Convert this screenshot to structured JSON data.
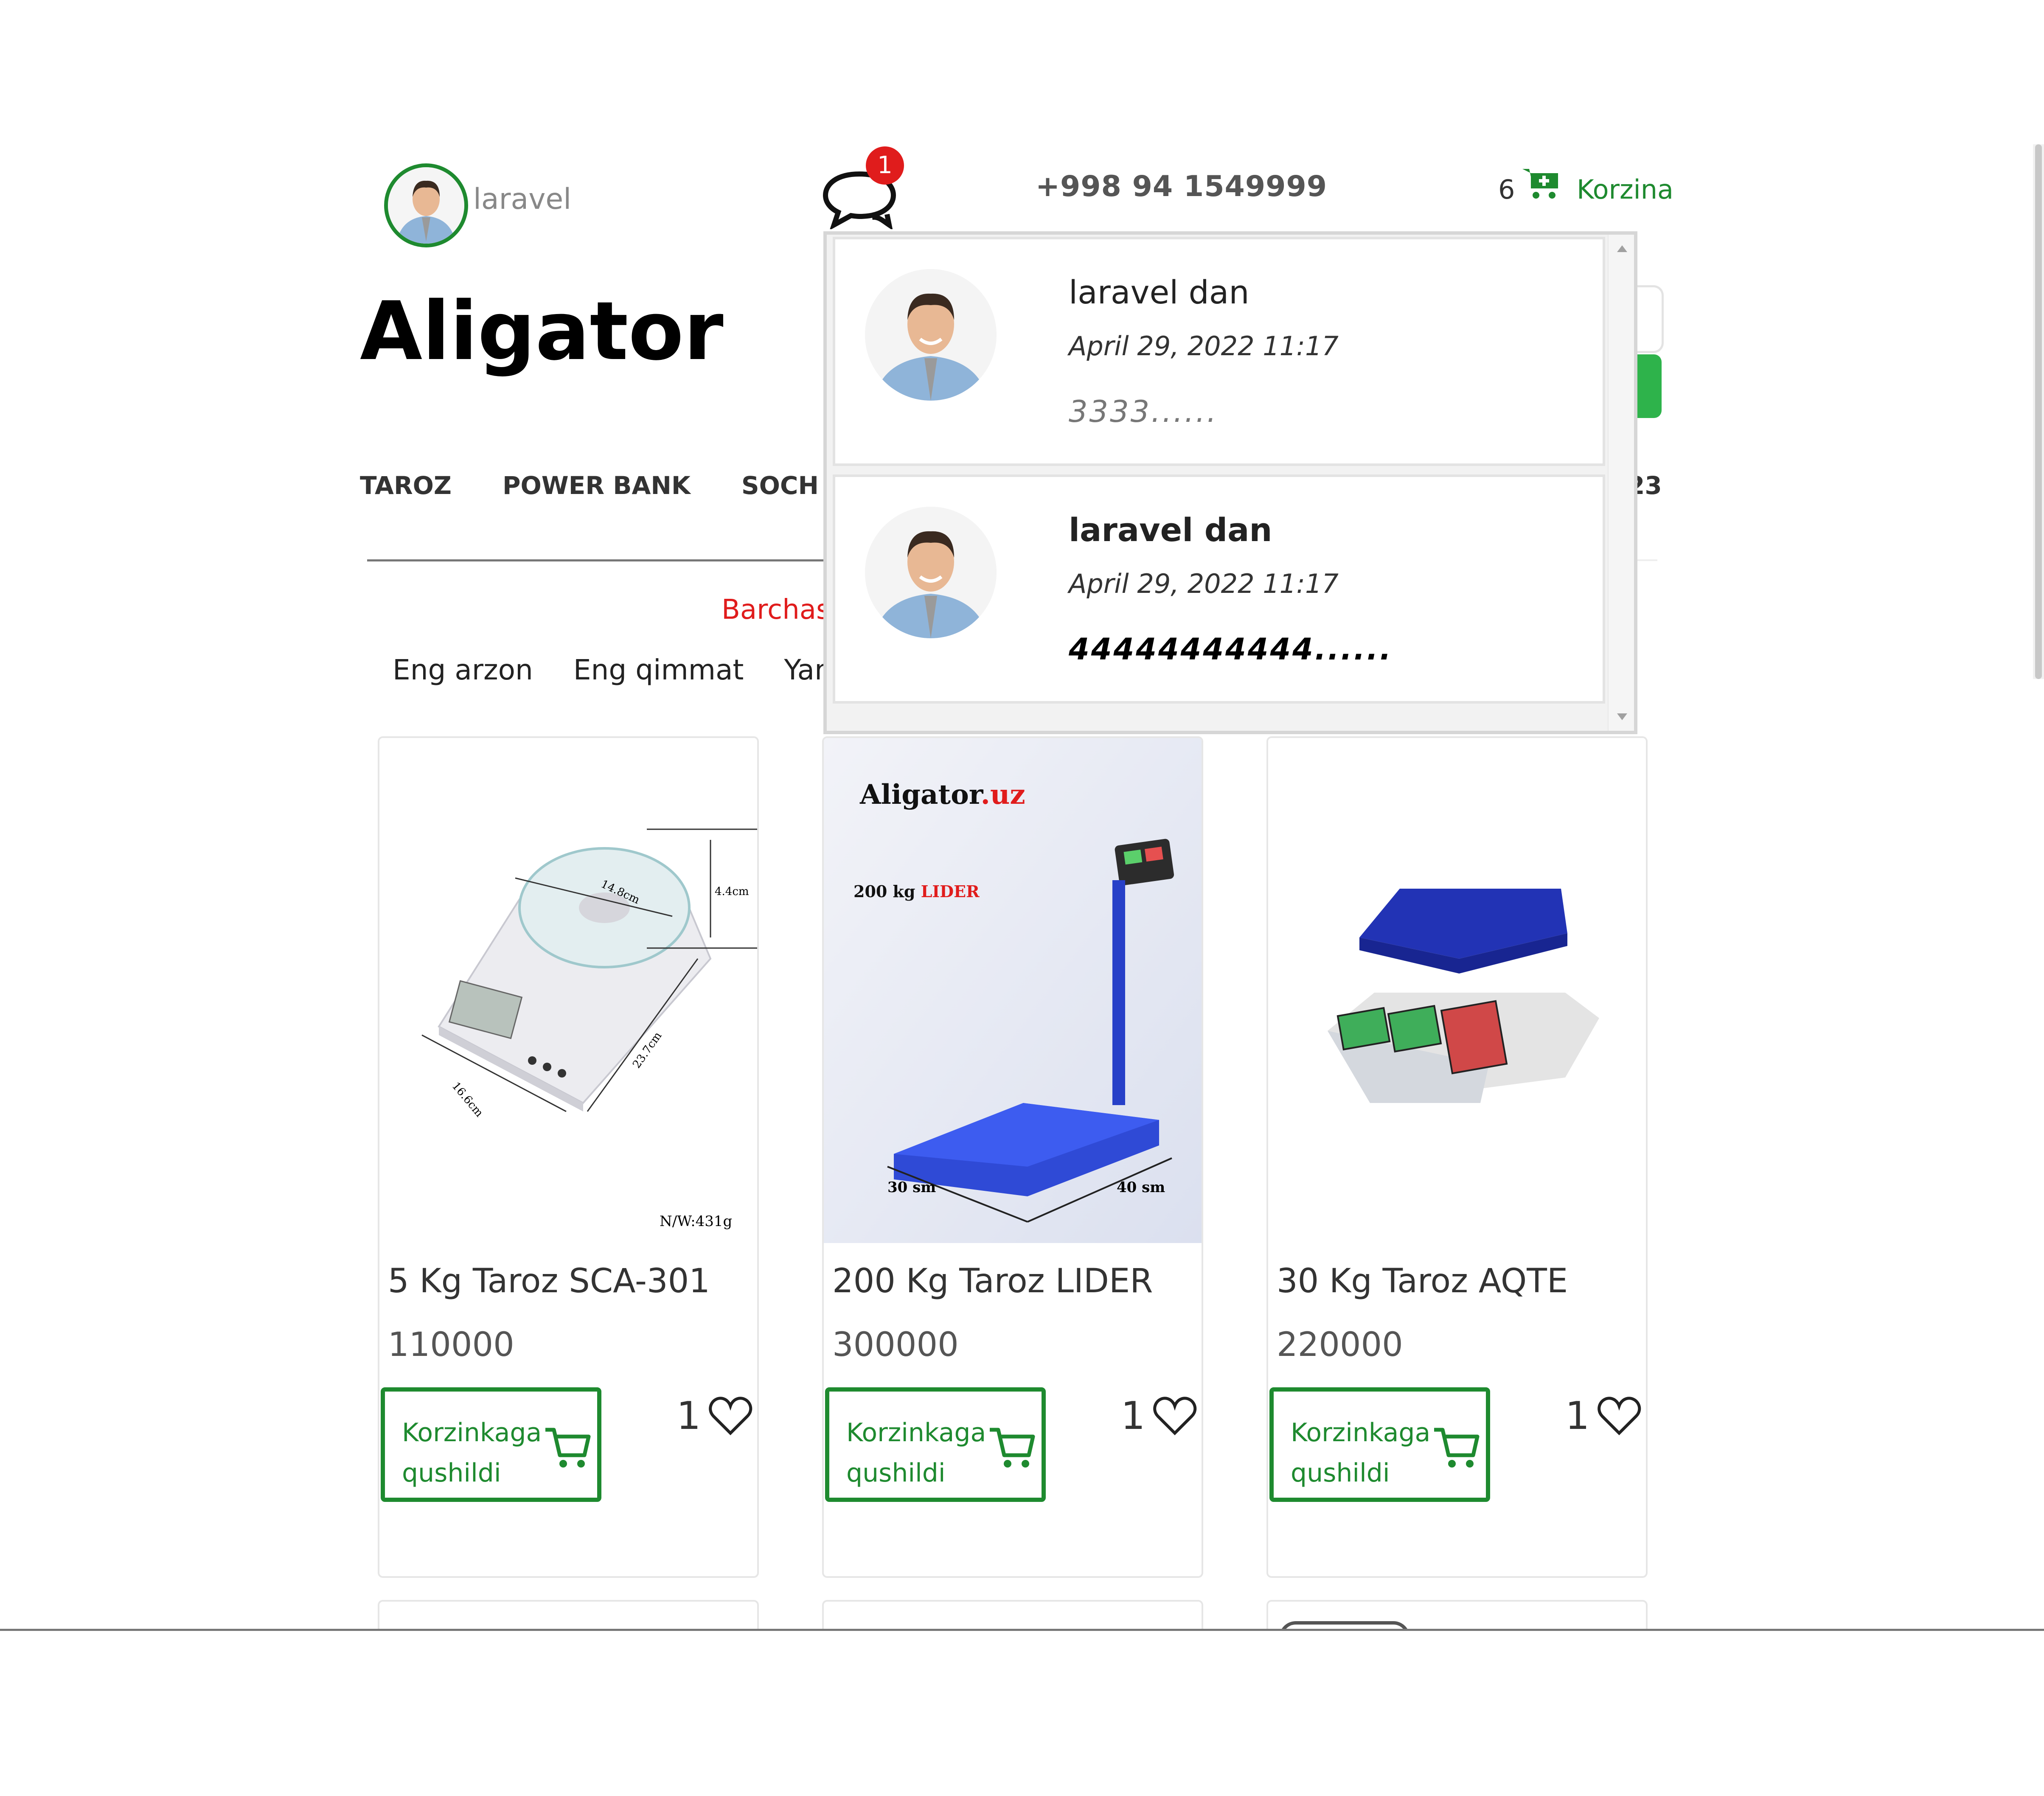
{
  "header": {
    "username": "laravel",
    "chat_badge": "1",
    "phone": "+998 94 1549999",
    "cart_count": "6",
    "cart_label": "Korzina"
  },
  "logo": "Aligator",
  "categories": [
    "TAROZ",
    "POWER BANK",
    "SOCH OL"
  ],
  "categories_tail": "23",
  "filter": {
    "all_label": "Barchasi",
    "sort": [
      "Eng arzon",
      "Eng qimmat",
      "Yang"
    ]
  },
  "products": [
    {
      "name": "5 Kg Taroz SCA-301",
      "price": "110000",
      "button": "Korzinkaga qushildi",
      "likes": "1",
      "img_text": [
        "14.8cm",
        "4.4cm",
        "16.6cm",
        "23.7cm",
        "N/W:431g"
      ]
    },
    {
      "name": "200 Kg Taroz LIDER",
      "price": "300000",
      "button": "Korzinkaga qushildi",
      "likes": "1",
      "img_brand": "Aligator",
      "img_brand_suffix": ".uz",
      "img_model_kg": "200 kg ",
      "img_model_name": "LIDER",
      "img_dims": [
        "30 sm",
        "40 sm"
      ]
    },
    {
      "name": "30 Kg Taroz AQTE",
      "price": "220000",
      "button": "Korzinkaga qushildi",
      "likes": "1"
    }
  ],
  "messages": [
    {
      "from": "laravel dan",
      "date": "April 29, 2022 11:17",
      "text": "3333......",
      "unread": false
    },
    {
      "from": "laravel dan",
      "date": "April 29, 2022 11:17",
      "text": "44444444444......",
      "unread": true
    }
  ],
  "colors": {
    "accent": "#1e8a2f",
    "badge": "#e01c1c",
    "link_red": "#e01c1c",
    "search_green": "#2eb34b"
  },
  "icons": [
    "user-avatar",
    "chat-bubbles-icon",
    "cart-plus-icon",
    "cart-icon",
    "heart-icon"
  ]
}
